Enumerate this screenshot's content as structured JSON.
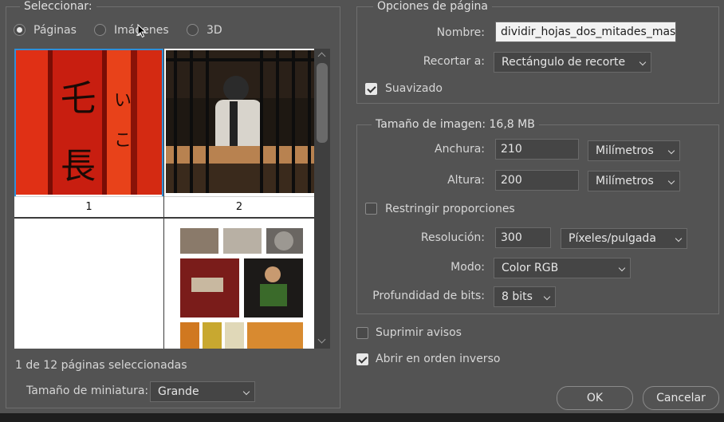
{
  "select_group": {
    "legend": "Seleccionar:",
    "radios": [
      {
        "label": "Páginas",
        "checked": true
      },
      {
        "label": "Imágenes",
        "checked": false
      },
      {
        "label": "3D",
        "checked": false
      }
    ]
  },
  "thumbnails": [
    {
      "caption": "1",
      "selected": true,
      "icon": "red-lanterns-photo"
    },
    {
      "caption": "2",
      "selected": false,
      "icon": "street-food-cook-photo"
    },
    {
      "caption": "",
      "selected": false,
      "icon": "blank-page"
    },
    {
      "caption": "",
      "selected": false,
      "icon": "photo-collage-page"
    }
  ],
  "selection_status": "1 de 12 páginas seleccionadas",
  "thumb_size": {
    "label": "Tamaño de miniatura:",
    "value": "Grande"
  },
  "page_options": {
    "legend": "Opciones de página",
    "name_label": "Nombre:",
    "name_value": "dividir_hojas_dos_mitades_mas_g",
    "crop_label": "Recortar a:",
    "crop_value": "Rectángulo de recorte",
    "smooth_label": "Suavizado",
    "smooth_checked": true
  },
  "image_size": {
    "legend": "Tamaño de imagen: 16,8 MB",
    "width_label": "Anchura:",
    "width_value": "210",
    "width_unit": "Milímetros",
    "height_label": "Altura:",
    "height_value": "200",
    "height_unit": "Milímetros",
    "constrain_label": "Restringir proporciones",
    "constrain_checked": false,
    "resolution_label": "Resolución:",
    "resolution_value": "300",
    "resolution_unit": "Píxeles/pulgada",
    "mode_label": "Modo:",
    "mode_value": "Color RGB",
    "depth_label": "Profundidad de bits:",
    "depth_value": "8 bits"
  },
  "suppress_label": "Suprimir avisos",
  "suppress_checked": false,
  "reverse_label": "Abrir en orden inverso",
  "reverse_checked": true,
  "buttons": {
    "ok": "OK",
    "cancel": "Cancelar"
  },
  "colors": {
    "selection": "#2f8fd8",
    "dialog_bg": "#535353"
  }
}
